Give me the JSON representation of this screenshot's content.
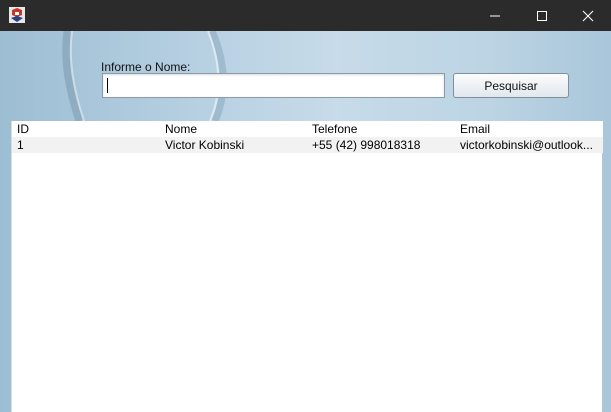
{
  "window": {
    "icons": {
      "app": "java-app-icon",
      "minimize": "minimize-icon",
      "maximize": "maximize-icon",
      "close": "close-icon"
    }
  },
  "search": {
    "label": "Informe o Nome:",
    "value": "",
    "placeholder": "",
    "button_label": "Pesquisar"
  },
  "table": {
    "columns": [
      "ID",
      "Nome",
      "Telefone",
      "Email"
    ],
    "rows": [
      [
        "1",
        "Victor Kobinski",
        "+55 (42) 998018318",
        "victorkobinski@outlook..."
      ]
    ]
  },
  "colors": {
    "titlebar": "#2b2b2b",
    "background": "#b5cfe1",
    "row_alt": "#f2f2f2"
  }
}
